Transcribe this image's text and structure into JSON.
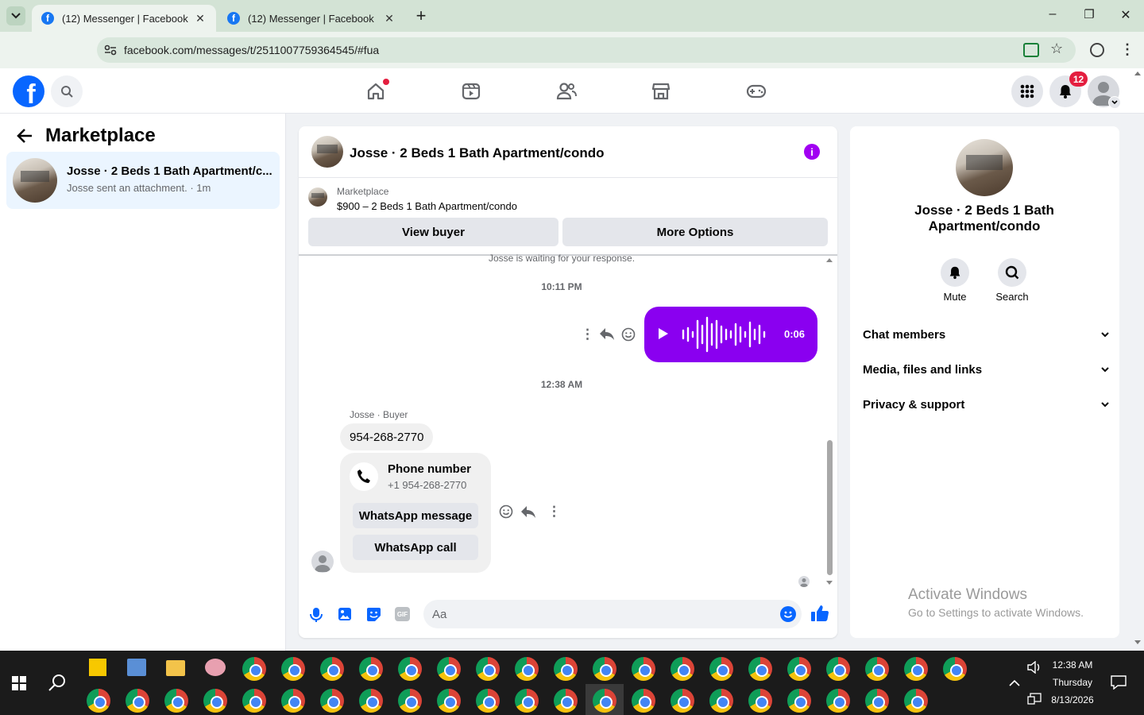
{
  "browser": {
    "tabs": [
      {
        "title": "(12) Messenger | Facebook",
        "active": true
      },
      {
        "title": "(12) Messenger | Facebook",
        "active": false
      }
    ],
    "new_tab": "+",
    "url": "facebook.com/messages/t/2511007759364545/#fua",
    "window_controls": {
      "minimize": "–",
      "maximize": "❐",
      "close": "✕"
    }
  },
  "fb_header": {
    "logo": "f",
    "notifications_count": "12",
    "nav_icons": [
      "home-icon",
      "video-icon",
      "friends-icon",
      "marketplace-icon",
      "gaming-icon"
    ]
  },
  "left_panel": {
    "title": "Marketplace",
    "conversations": [
      {
        "name": "Josse · 2 Beds 1 Bath Apartment/c...",
        "preview": "Josse sent an attachment. · 1m"
      }
    ]
  },
  "chat": {
    "header_title": "Josse · 2 Beds 1 Bath Apartment/condo",
    "listing": {
      "source": "Marketplace",
      "title": "$900 – 2 Beds 1 Bath Apartment/condo"
    },
    "buttons": {
      "view_buyer": "View buyer",
      "more_options": "More Options"
    },
    "system_note": "Josse is waiting for your response.",
    "timestamps": [
      "10:11 PM",
      "12:38 AM"
    ],
    "voice_message": {
      "duration": "0:06",
      "color": "#8a00f0"
    },
    "sender_label": "Josse · Buyer",
    "text_message": "954-268-2770",
    "phone_card": {
      "title": "Phone number",
      "number": "+1 954-268-2770",
      "whatsapp_message": "WhatsApp message",
      "whatsapp_call": "WhatsApp call"
    },
    "composer": {
      "placeholder": "Aa"
    }
  },
  "right_panel": {
    "name": "Josse · 2 Beds 1 Bath Apartment/condo",
    "actions": [
      {
        "label": "Mute"
      },
      {
        "label": "Search"
      }
    ],
    "sections": [
      "Chat members",
      "Media, files and links",
      "Privacy & support"
    ]
  },
  "watermark": {
    "title": "Activate Windows",
    "subtitle": "Go to Settings to activate Windows."
  },
  "taskbar": {
    "time": "12:38 AM",
    "day": "Thursday",
    "date": "8/13/2026"
  },
  "colors": {
    "accent": "#0866ff",
    "voice": "#8a00f0",
    "info": "#a100f2",
    "badge": "#e41e3f"
  }
}
